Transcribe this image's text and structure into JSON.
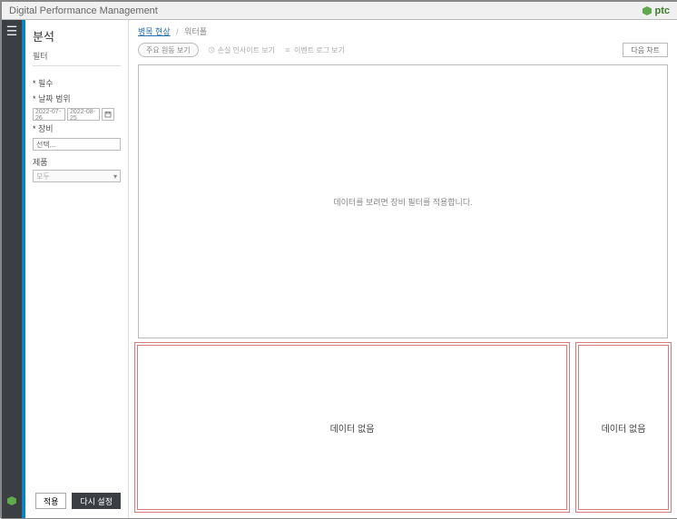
{
  "header": {
    "title": "Digital Performance Management",
    "brand": "ptc"
  },
  "sidebar": {
    "page_title": "분석",
    "filter_label": "필터",
    "required_label": "필수",
    "date_range_label": "날짜 범위",
    "date_from": "2022-07-26",
    "date_to": "2022-08-25",
    "equipment_label": "장비",
    "equipment_value": "선택...",
    "material_label": "제품",
    "material_value": "모두",
    "apply_label": "적용",
    "reset_label": "다시 설정"
  },
  "breadcrumb": {
    "root": "병목 현상",
    "current": "워터폴"
  },
  "toolbar": {
    "summary_btn": "주요 원동 보기",
    "loss_insights_btn": "손실 인사이트 보기",
    "event_log_btn": "이벤트 로그 보기",
    "next_chart_btn": "다음 차트"
  },
  "main": {
    "empty_chart_msg": "데이터를 보려면 장비 필터를 적용합니다.",
    "no_data_left": "데이터 없음",
    "no_data_right": "데이터 없음"
  }
}
